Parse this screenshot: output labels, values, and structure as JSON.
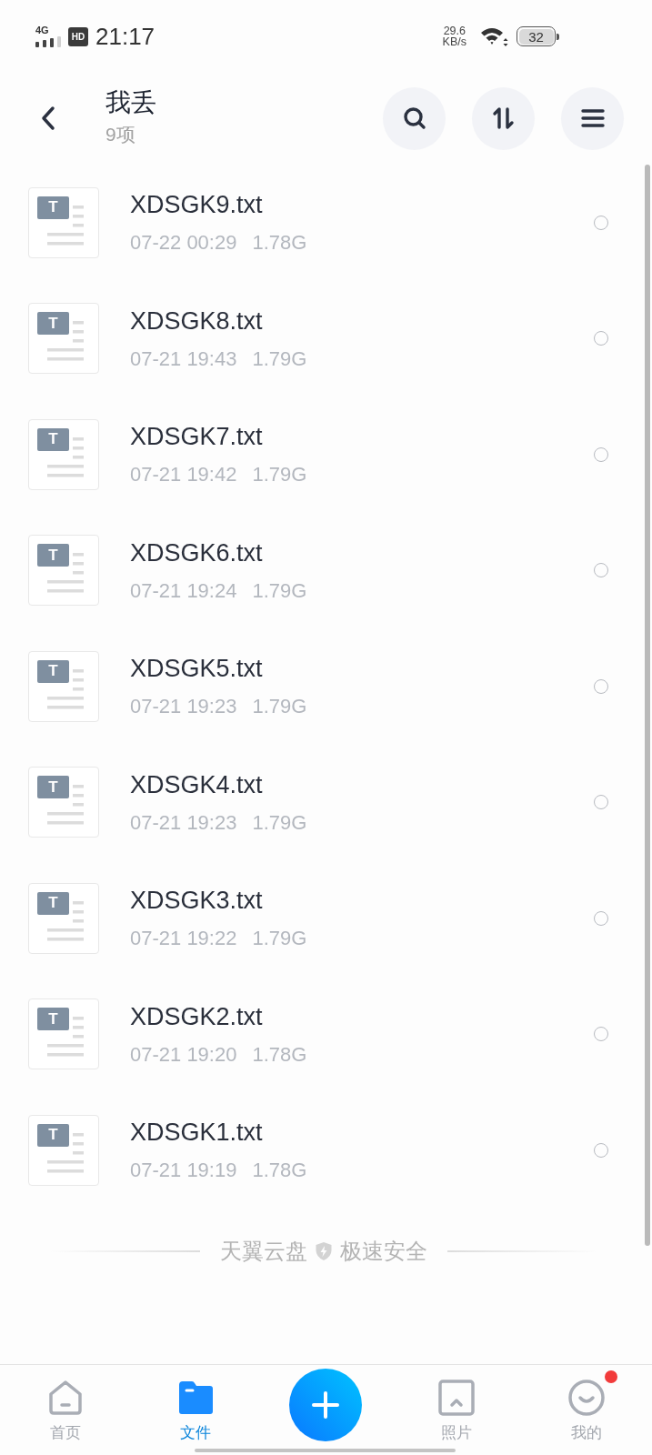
{
  "status_bar": {
    "network": "4G",
    "hd": "HD",
    "time": "21:17",
    "speed": "29.6",
    "speed_unit": "KB/s",
    "battery": "32"
  },
  "header": {
    "title": "我丢",
    "subtitle": "9项"
  },
  "files": [
    {
      "icon_letter": "T",
      "name": "XDSGK9.txt",
      "date": "07-22 00:29",
      "size": "1.78G",
      "selected": false
    },
    {
      "icon_letter": "T",
      "name": "XDSGK8.txt",
      "date": "07-21 19:43",
      "size": "1.79G",
      "selected": false
    },
    {
      "icon_letter": "T",
      "name": "XDSGK7.txt",
      "date": "07-21 19:42",
      "size": "1.79G",
      "selected": false
    },
    {
      "icon_letter": "T",
      "name": "XDSGK6.txt",
      "date": "07-21 19:24",
      "size": "1.79G",
      "selected": false
    },
    {
      "icon_letter": "T",
      "name": "XDSGK5.txt",
      "date": "07-21 19:23",
      "size": "1.79G",
      "selected": false
    },
    {
      "icon_letter": "T",
      "name": "XDSGK4.txt",
      "date": "07-21 19:23",
      "size": "1.79G",
      "selected": false
    },
    {
      "icon_letter": "T",
      "name": "XDSGK3.txt",
      "date": "07-21 19:22",
      "size": "1.79G",
      "selected": false
    },
    {
      "icon_letter": "T",
      "name": "XDSGK2.txt",
      "date": "07-21 19:20",
      "size": "1.78G",
      "selected": false
    },
    {
      "icon_letter": "T",
      "name": "XDSGK1.txt",
      "date": "07-21 19:19",
      "size": "1.78G",
      "selected": false
    }
  ],
  "footer": {
    "brand": "天翼云盘",
    "slogan": "极速安全"
  },
  "bottom_nav": {
    "items": [
      {
        "kind": "tab",
        "label": "首页",
        "selected": false,
        "badge": false
      },
      {
        "kind": "tab",
        "label": "文件",
        "selected": true,
        "badge": false
      },
      {
        "kind": "add",
        "selected": false
      },
      {
        "kind": "tab",
        "label": "照片",
        "selected": false,
        "badge": false
      },
      {
        "kind": "tab",
        "label": "我的",
        "selected": false,
        "badge": true
      }
    ]
  }
}
